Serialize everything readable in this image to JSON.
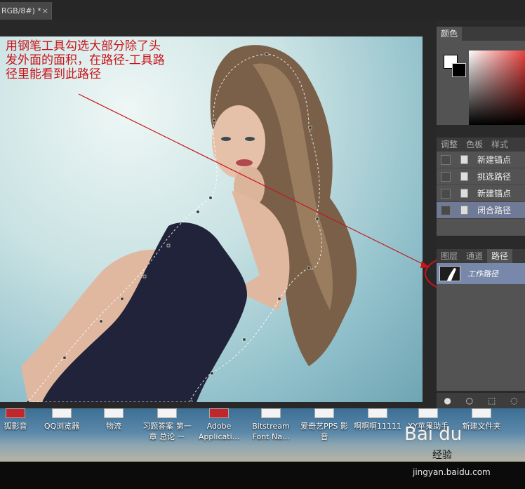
{
  "document": {
    "tab_title": "RGB/8#) *",
    "tab_close": "×"
  },
  "annotation": {
    "text": "用钢笔工具勾选大部分除了头发外面的面积，在路径-工具路径里能看到此路径",
    "color": "#c8141a"
  },
  "panels": {
    "color": {
      "tabs": [
        "颜色"
      ]
    },
    "adjust": {
      "tabs": [
        "调整",
        "色板",
        "样式"
      ],
      "actions": [
        {
          "label": "新建锚点",
          "selected": false
        },
        {
          "label": "挑选路径",
          "selected": false
        },
        {
          "label": "新建锚点",
          "selected": false
        },
        {
          "label": "闭合路径",
          "selected": true
        }
      ]
    },
    "paths": {
      "tabs": [
        "图层",
        "通道",
        "路径"
      ],
      "active_tab": "路径",
      "items": [
        {
          "label": "工作路径",
          "selected": true
        }
      ],
      "footer_icons": [
        "fill-circle-icon",
        "stroke-circle-icon",
        "selection-icon",
        "mask-icon"
      ]
    }
  },
  "desktop": {
    "icons": [
      {
        "label": "狐影音"
      },
      {
        "label": "QQ浏览器"
      },
      {
        "label": "物流"
      },
      {
        "label": "习题答案 第一章 总论 －"
      },
      {
        "label": "Adobe Applicati..."
      },
      {
        "label": "Bitstream Font Na..."
      },
      {
        "label": "爱奇艺PPS 影音"
      },
      {
        "label": "啊啊啊11111"
      },
      {
        "label": "XY苹果助手"
      },
      {
        "label": "新建文件夹"
      }
    ]
  },
  "watermark": {
    "brand": "Bai du",
    "sub": "经验",
    "url": "jingyan.baidu.com"
  }
}
